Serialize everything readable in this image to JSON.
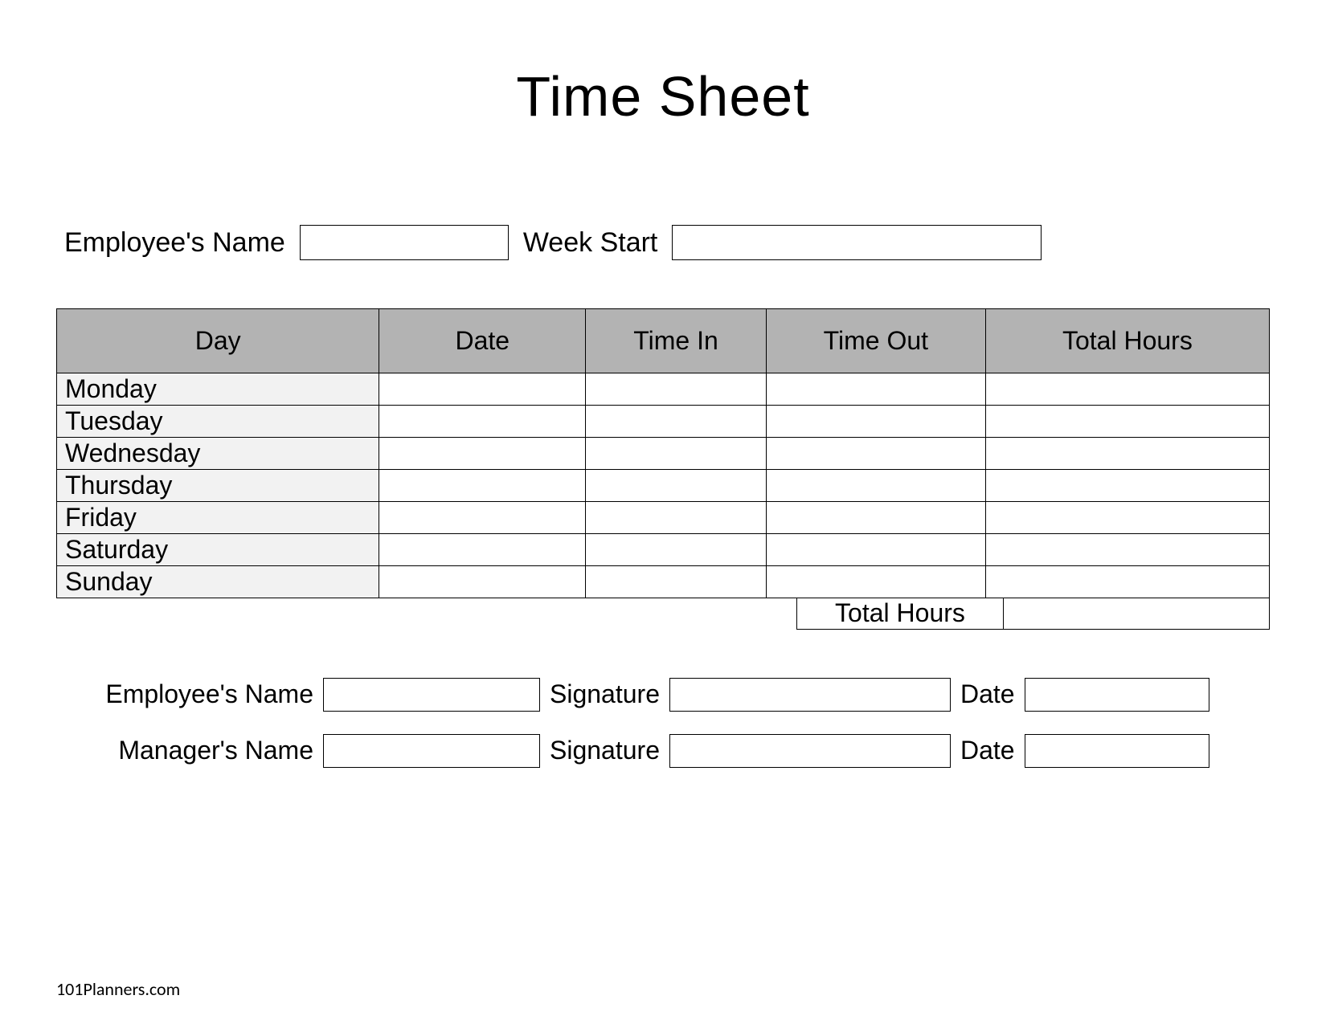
{
  "title": "Time Sheet",
  "top": {
    "employee_label": "Employee's Name",
    "week_start_label": "Week Start"
  },
  "table": {
    "headers": {
      "day": "Day",
      "date": "Date",
      "time_in": "Time In",
      "time_out": "Time Out",
      "total_hours": "Total Hours"
    },
    "days": [
      "Monday",
      "Tuesday",
      "Wednesday",
      "Thursday",
      "Friday",
      "Saturday",
      "Sunday"
    ],
    "totals_label": "Total Hours"
  },
  "signatures": {
    "employee_name_label": "Employee's Name",
    "manager_name_label": "Manager's Name",
    "signature_label": "Signature",
    "date_label": "Date"
  },
  "footer": "101Planners.com"
}
